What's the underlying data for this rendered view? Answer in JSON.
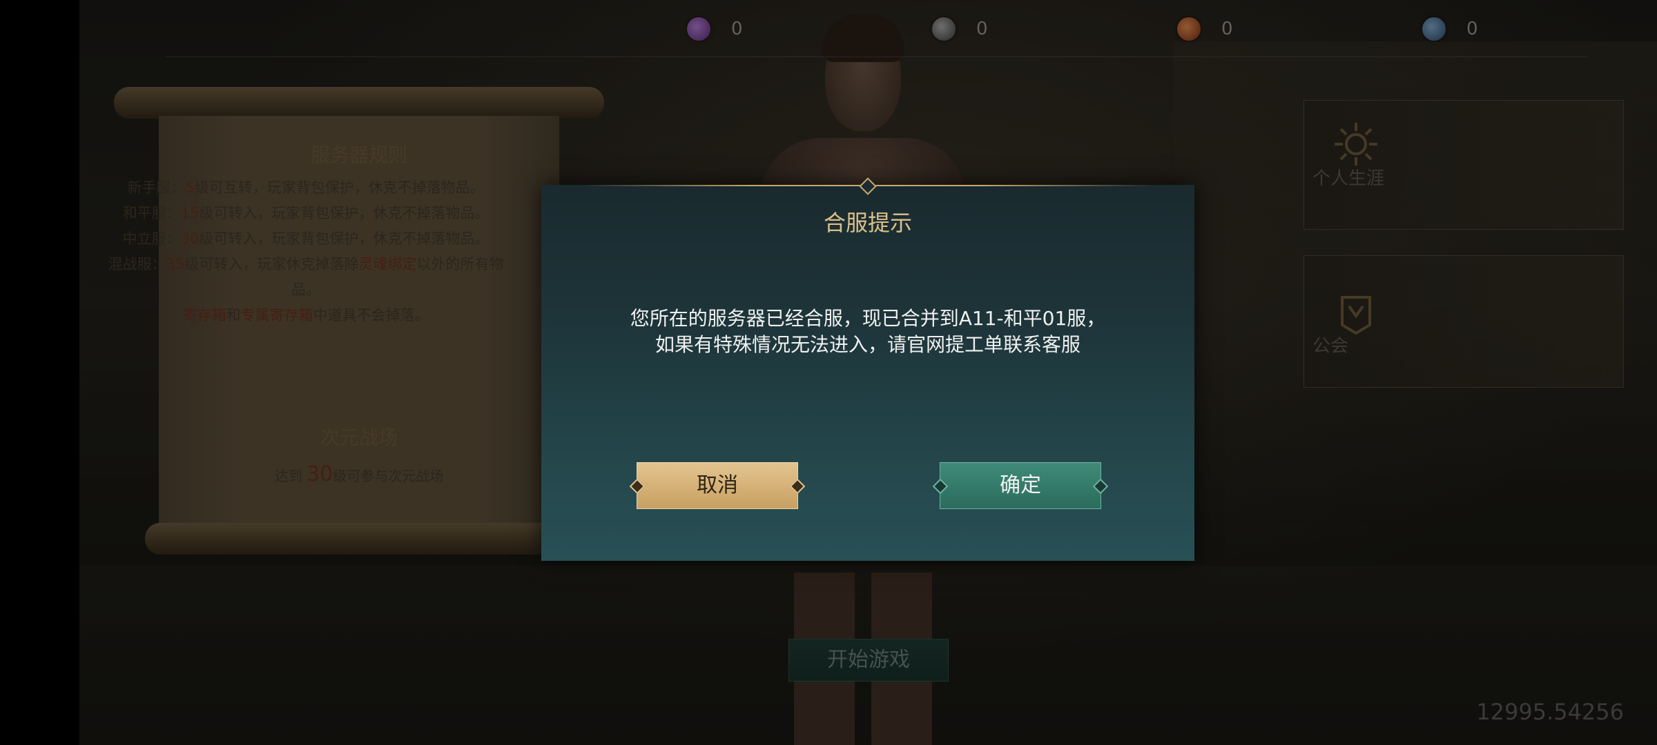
{
  "resources": [
    {
      "icon": "purple-orb-icon",
      "value": "0"
    },
    {
      "icon": "grey-orb-icon",
      "value": "0"
    },
    {
      "icon": "orange-orb-icon",
      "value": "0"
    },
    {
      "icon": "blue-orb-icon",
      "value": "0"
    }
  ],
  "scroll": {
    "title": "服务器规则",
    "rules": {
      "r1a": "新手服：",
      "r1n": "5",
      "r1b": "级可互转，玩家背包保护，休克不掉落物品。",
      "r2a": "和平服：",
      "r2n": "15",
      "r2b": "级可转入，玩家背包保护，休克不掉落物品。",
      "r3a": "中立服：",
      "r3n": "30",
      "r3b": "级可转入，玩家背包保护，休克不掉落物品。",
      "r4a": "混战服：",
      "r4n": "35",
      "r4b": "级可转入，玩家休克掉落除",
      "r4c": "灵魂绑定",
      "r4d": "以外的所有物品。",
      "r5a": "寄存箱",
      "r5b": "和",
      "r5c": "专属寄存箱",
      "r5d": "中道具不会掉落。"
    },
    "battle_title": "次元战场",
    "battle_pre": "达到 ",
    "battle_num": "30",
    "battle_post": "级可参与次元战场"
  },
  "panels": {
    "career_label": "个人生涯",
    "guild_label": "公会"
  },
  "start_button": "开始游戏",
  "version": "12995.54256",
  "dialog": {
    "title": "合服提示",
    "line1": "您所在的服务器已经合服，现已合并到A11-和平01服，",
    "line2": "如果有特殊情况无法进入，请官网提工单联系客服",
    "cancel": "取消",
    "confirm": "确定"
  },
  "colors": {
    "accent_gold": "#dcc08b",
    "cancel_button": "#d8b57a",
    "confirm_button": "#367a69",
    "dialog_bg": "#1d3439"
  }
}
